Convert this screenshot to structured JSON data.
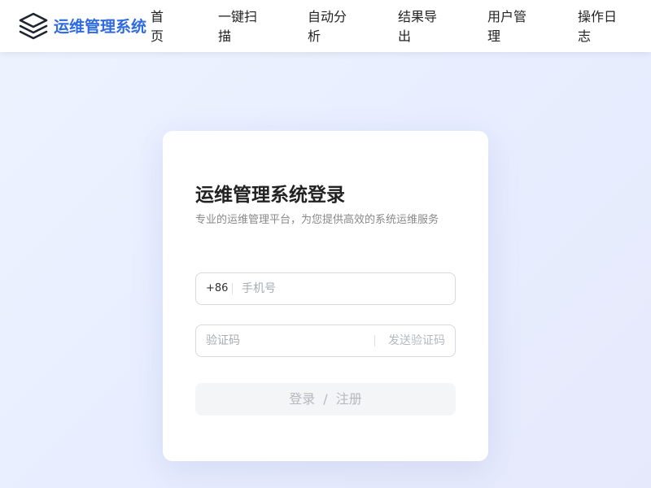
{
  "header": {
    "logo_icon": "stacked-layers-icon",
    "brand": "运维管理系统",
    "brand_color": "#2f6be0",
    "nav": [
      {
        "label": "首页"
      },
      {
        "label": "一键扫描"
      },
      {
        "label": "自动分析"
      },
      {
        "label": "结果导出"
      },
      {
        "label": "用户管理"
      },
      {
        "label": "操作日志"
      }
    ]
  },
  "login": {
    "title": "运维管理系统登录",
    "subtitle": "专业的运维管理平台，为您提供高效的系统运维服务",
    "phone_prefix": "+86",
    "phone_placeholder": "手机号",
    "phone_value": "",
    "code_placeholder": "验证码",
    "code_value": "",
    "send_code_label": "发送验证码",
    "submit_login": "登录",
    "submit_separator": "/",
    "submit_register": "注册"
  }
}
